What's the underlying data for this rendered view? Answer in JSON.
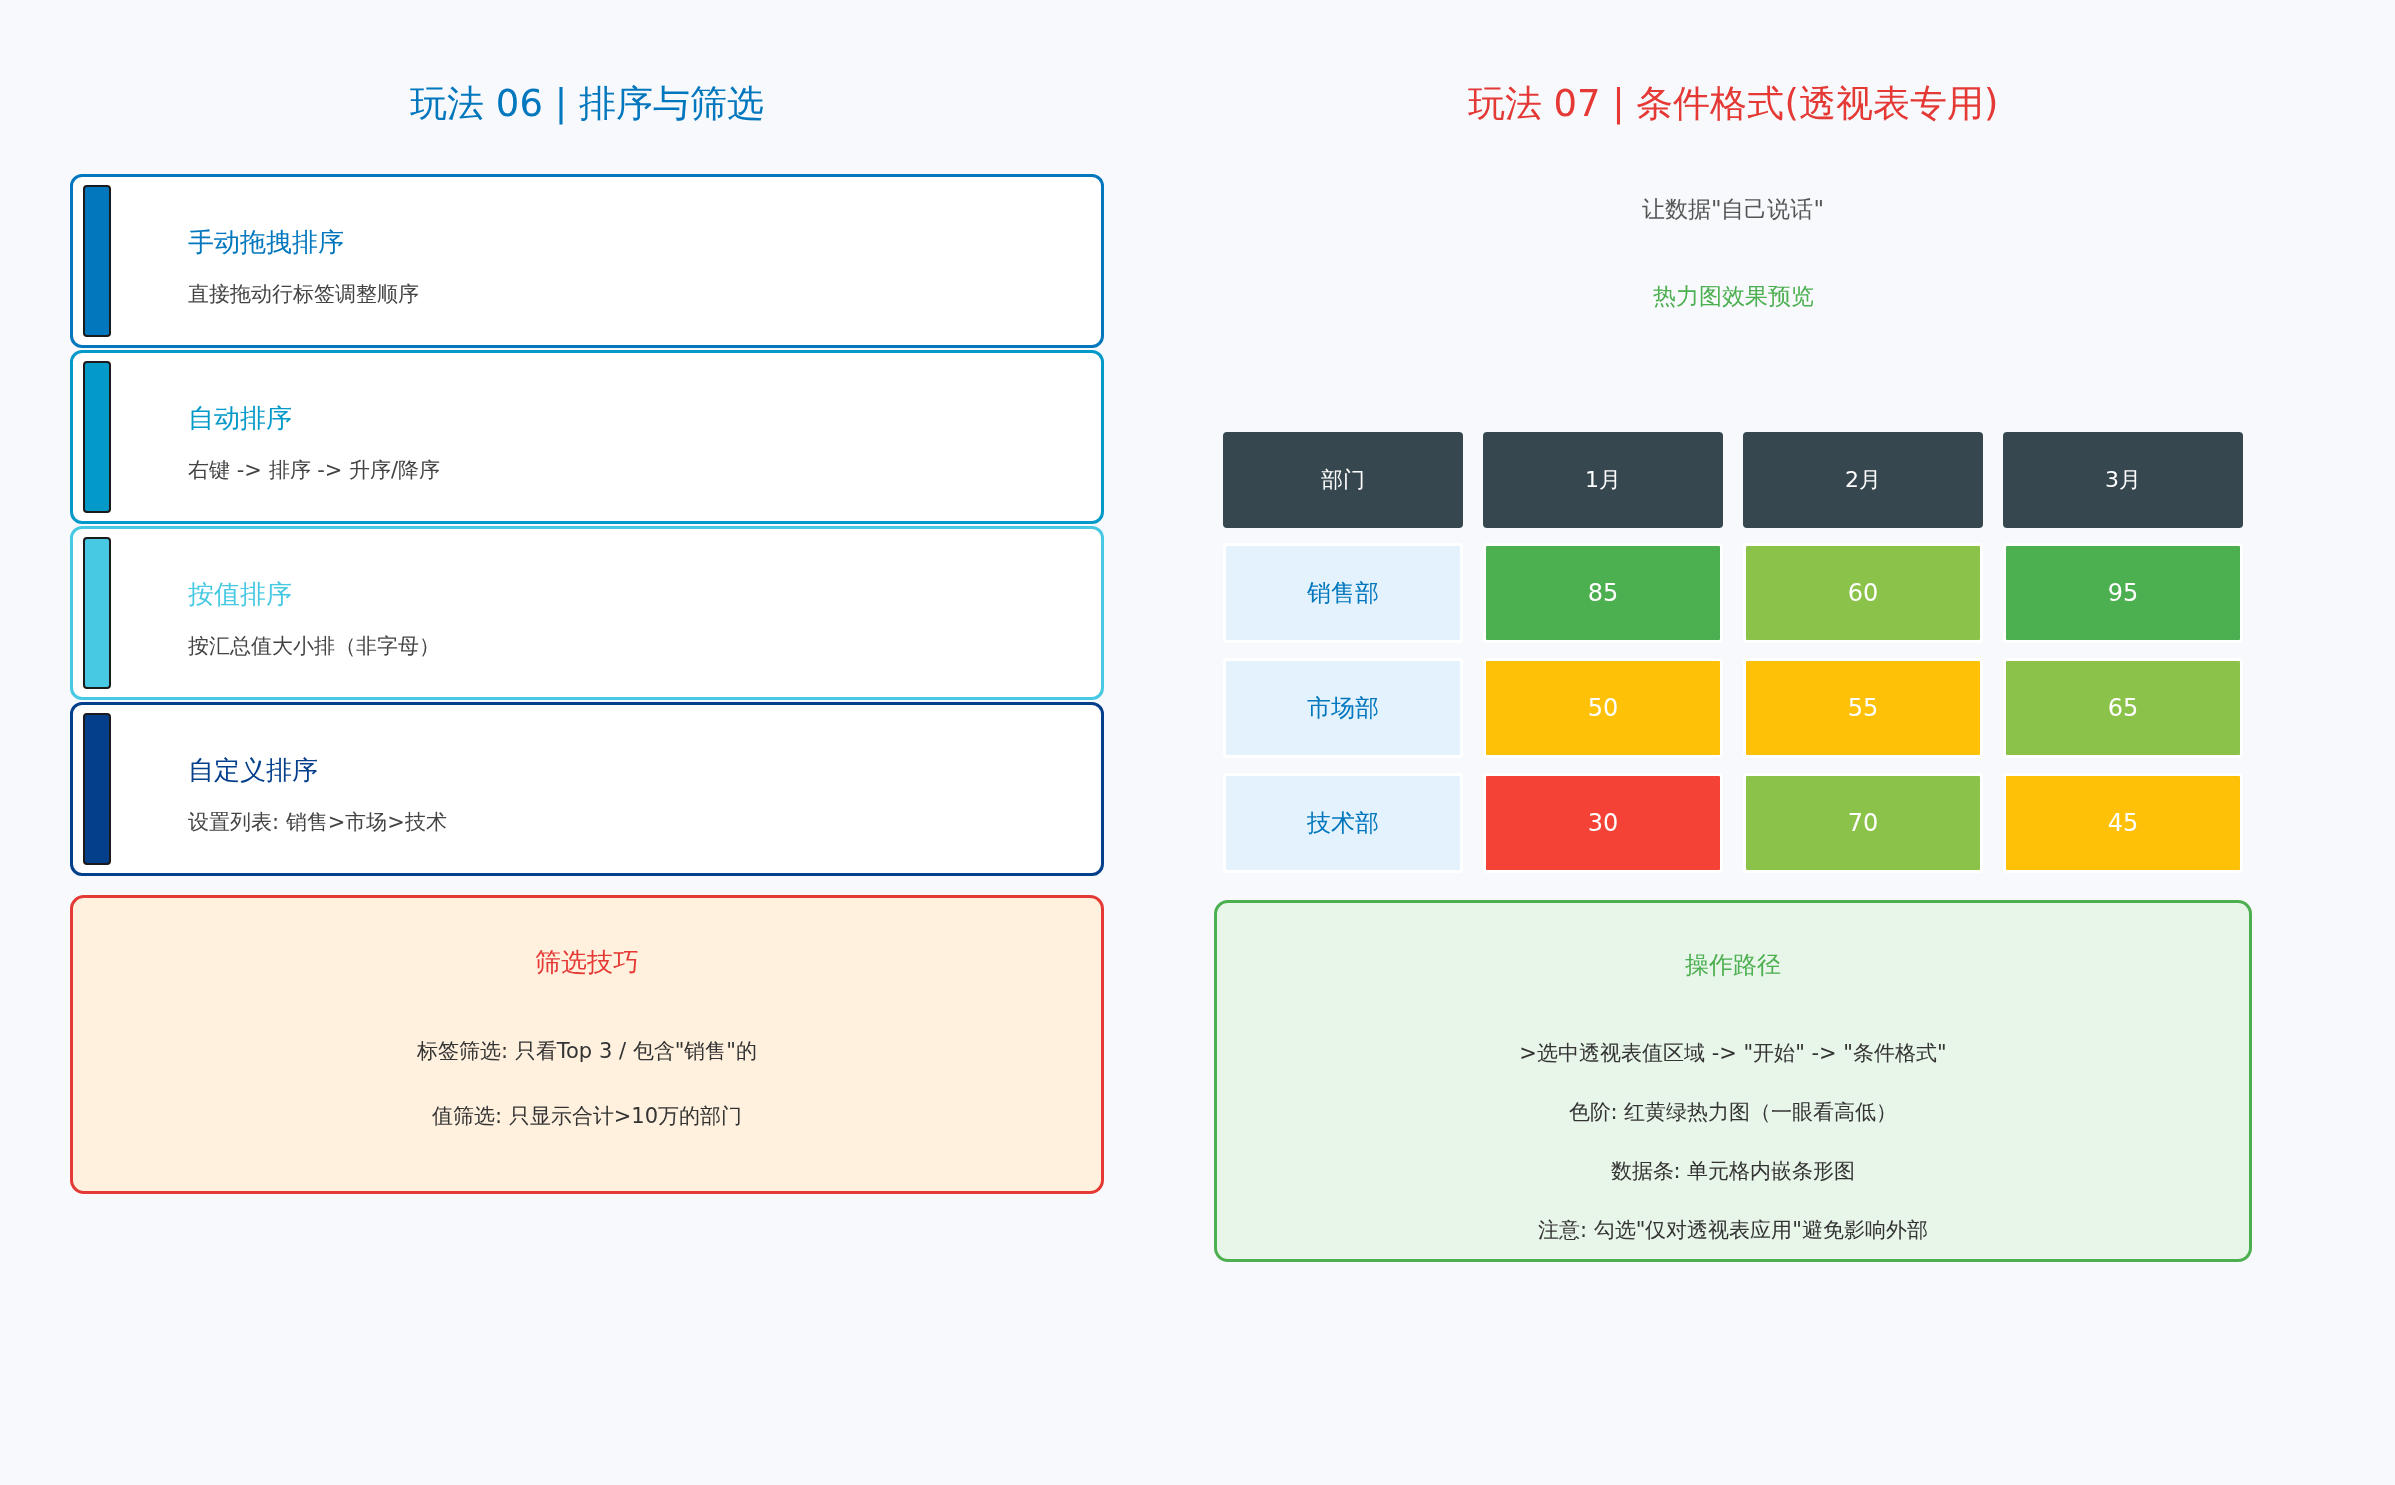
{
  "left_panel": {
    "title": "玩法 06 | 排序与筛选",
    "cards": [
      {
        "title": "手动拖拽排序",
        "description": "直接拖动行标签调整顺序",
        "color": "#0277bd"
      },
      {
        "title": "自动排序",
        "description": "右键 -> 排序 -> 升序/降序",
        "color": "#0399c8"
      },
      {
        "title": "按值排序",
        "description": "按汇总值大小排（非字母）",
        "color": "#48c9e3"
      },
      {
        "title": "自定义排序",
        "description": "设置列表: 销售>市场>技术",
        "color": "#043f8b"
      }
    ],
    "filter_tips": {
      "title": "筛选技巧",
      "lines": [
        "标签筛选: 只看Top 3 / 包含\"销售\"的",
        "值筛选: 只显示合计>10万的部门"
      ]
    }
  },
  "right_panel": {
    "title": "玩法 07 | 条件格式(透视表专用)",
    "subtitle": "让数据\"自己说话\"",
    "preview_label": "热力图效果预览",
    "heatmap": {
      "columns": [
        "部门",
        "1月",
        "2月",
        "3月"
      ],
      "rows": [
        {
          "cells": [
            {
              "kind": "label",
              "value": "销售部"
            },
            {
              "kind": "value",
              "value": "85",
              "color": "#4caf50"
            },
            {
              "kind": "value",
              "value": "60",
              "color": "#8bc34a"
            },
            {
              "kind": "value",
              "value": "95",
              "color": "#4caf50"
            }
          ]
        },
        {
          "cells": [
            {
              "kind": "label",
              "value": "市场部"
            },
            {
              "kind": "value",
              "value": "50",
              "color": "#ffc107"
            },
            {
              "kind": "value",
              "value": "55",
              "color": "#ffc107"
            },
            {
              "kind": "value",
              "value": "65",
              "color": "#8bc34a"
            }
          ]
        },
        {
          "cells": [
            {
              "kind": "label",
              "value": "技术部"
            },
            {
              "kind": "value",
              "value": "30",
              "color": "#f44336"
            },
            {
              "kind": "value",
              "value": "70",
              "color": "#8bc34a"
            },
            {
              "kind": "value",
              "value": "45",
              "color": "#ffc107"
            }
          ]
        }
      ]
    },
    "steps_box": {
      "title": "操作路径",
      "lines": [
        ">选中透视表值区域 -> \"开始\" -> \"条件格式\"",
        "色阶: 红黄绿热力图（一眼看高低）",
        "数据条: 单元格内嵌条形图",
        "注意: 勾选\"仅对透视表应用\"避免影响外部"
      ]
    }
  }
}
